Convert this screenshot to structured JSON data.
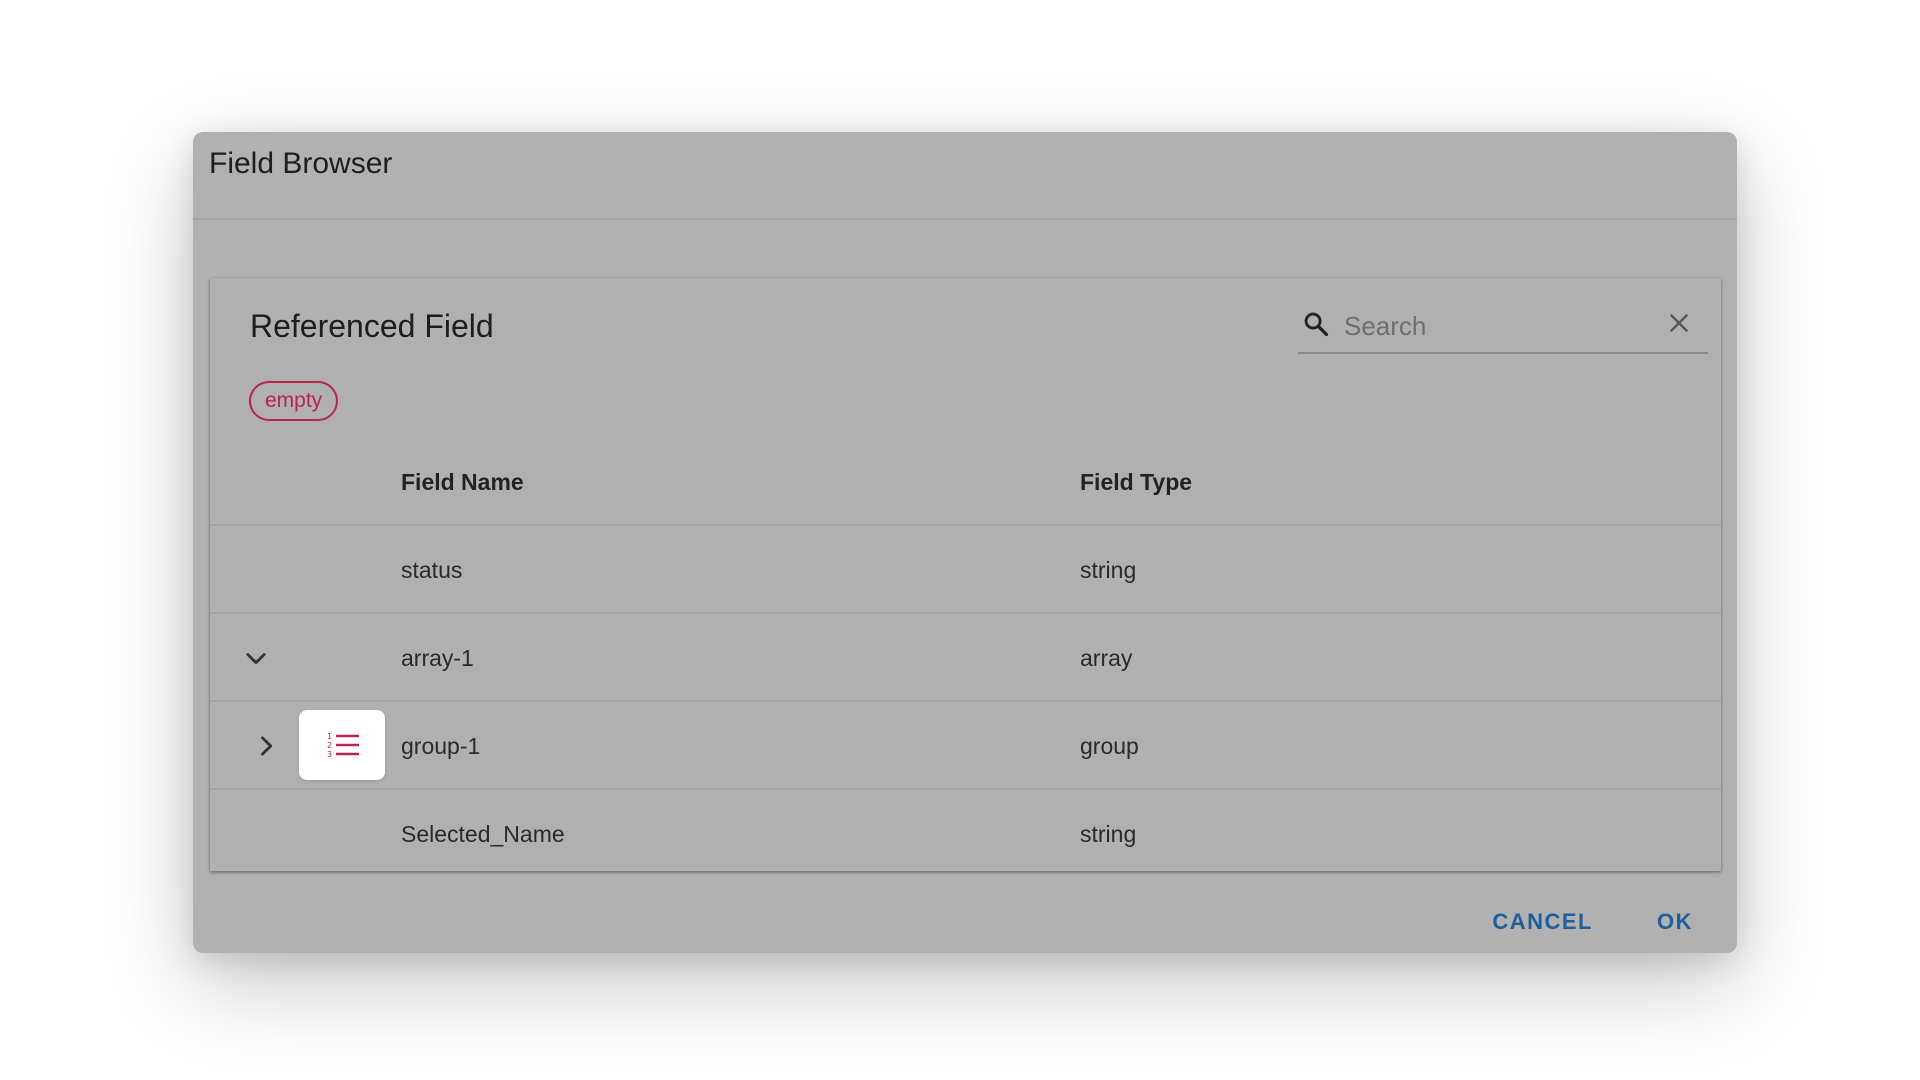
{
  "dialog": {
    "title": "Field Browser",
    "cancel_label": "CANCEL",
    "ok_label": "OK"
  },
  "panel": {
    "title": "Referenced Field",
    "chip_label": "empty",
    "search": {
      "placeholder": "Search",
      "value": ""
    }
  },
  "table": {
    "headers": {
      "field_name": "Field Name",
      "field_type": "Field Type"
    },
    "rows": [
      {
        "name": "status",
        "type": "string",
        "expander": "none"
      },
      {
        "name": "array-1",
        "type": "array",
        "expander": "expanded"
      },
      {
        "name": "group-1",
        "type": "group",
        "expander": "collapsed",
        "icon": "list-numbered-icon"
      },
      {
        "name": "Selected_Name",
        "type": "string",
        "expander": "none"
      }
    ]
  },
  "colors": {
    "accent": "#b8254d",
    "action": "#1f5f9e",
    "overlay_gray": "#b1b1b1"
  }
}
